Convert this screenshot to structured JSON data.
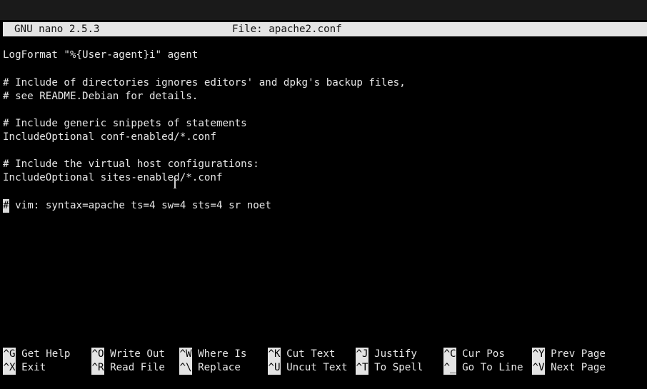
{
  "titlebar": {
    "app": "GNU nano 2.5.3",
    "file": "File: apache2.conf"
  },
  "editor": {
    "lines": [
      "LogFormat \"%{User-agent}i\" agent",
      "# Include of directories ignores editors' and dpkg's backup files,",
      "# see README.Debian for details.",
      "# Include generic snippets of statements",
      "IncludeOptional conf-enabled/*.conf",
      "# Include the virtual host configurations:",
      "IncludeOptional sites-enabled/*.conf"
    ],
    "cursor_char": "#",
    "cursor_line_rest": " vim: syntax=apache ts=4 sw=4 sts=4 sr noet"
  },
  "shortcuts": {
    "row1": [
      {
        "key": "^G",
        "label": "Get Help"
      },
      {
        "key": "^O",
        "label": "Write Out"
      },
      {
        "key": "^W",
        "label": "Where Is"
      },
      {
        "key": "^K",
        "label": "Cut Text"
      },
      {
        "key": "^J",
        "label": "Justify"
      },
      {
        "key": "^C",
        "label": "Cur Pos"
      },
      {
        "key": "^Y",
        "label": "Prev Page"
      }
    ],
    "row2": [
      {
        "key": "^X",
        "label": "Exit"
      },
      {
        "key": "^R",
        "label": "Read File"
      },
      {
        "key": "^\\",
        "label": "Replace"
      },
      {
        "key": "^U",
        "label": "Uncut Text"
      },
      {
        "key": "^T",
        "label": "To Spell"
      },
      {
        "key": "^_",
        "label": "Go To Line"
      },
      {
        "key": "^V",
        "label": "Next Page"
      }
    ]
  }
}
